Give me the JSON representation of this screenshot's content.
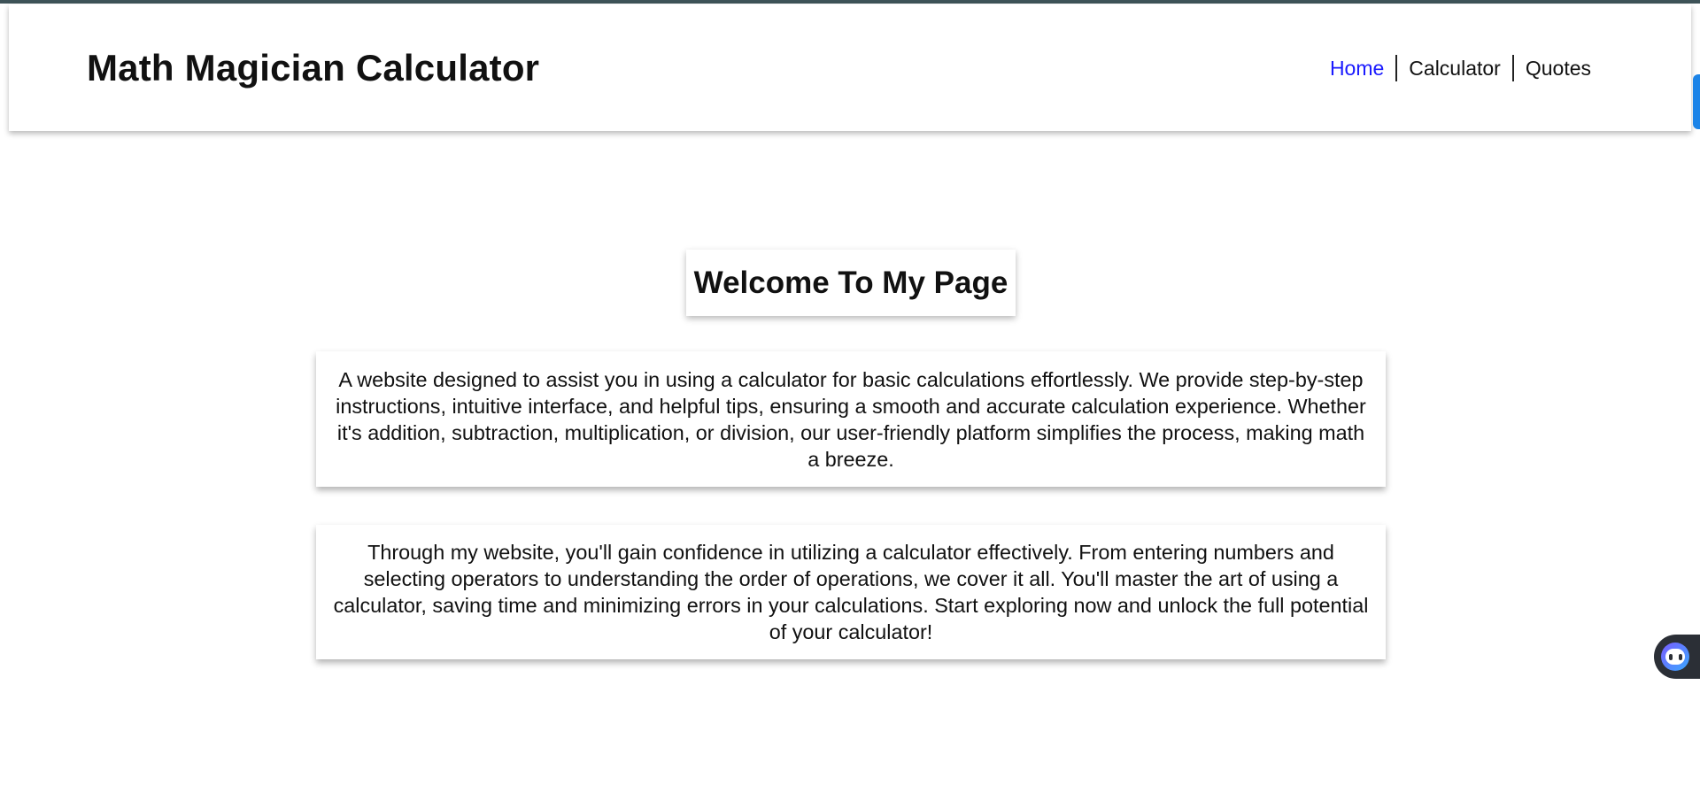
{
  "header": {
    "title": "Math Magician Calculator",
    "nav": [
      {
        "label": "Home",
        "active": true
      },
      {
        "label": "Calculator",
        "active": false
      },
      {
        "label": "Quotes",
        "active": false
      }
    ]
  },
  "main": {
    "heading": "Welcome To My Page",
    "paragraphs": [
      "A website designed to assist you in using a calculator for basic calculations effortlessly. We provide step-by-step instructions, intuitive interface, and helpful tips, ensuring a smooth and accurate calculation experience. Whether it's addition, subtraction, multiplication, or division, our user-friendly platform simplifies the process, making math a breeze.",
      "Through my website, you'll gain confidence in utilizing a calculator effectively. From entering numbers and selecting operators to understanding the order of operations, we cover it all. You'll master the art of using a calculator, saving time and minimizing errors in your calculations. Start exploring now and unlock the full potential of your calculator!"
    ]
  },
  "widgets": {
    "assistant_icon": "assistant-face-icon"
  },
  "colors": {
    "nav_active": "#1a1aff",
    "top_bar": "#3e5358",
    "scroll_tab": "#1c84e8"
  }
}
